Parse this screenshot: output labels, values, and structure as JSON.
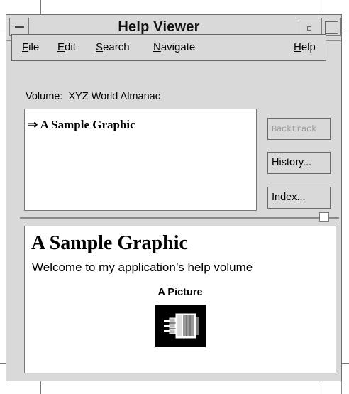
{
  "window": {
    "title": "Help Viewer",
    "window_menu_icon": "window-menu-icon",
    "minimize_icon": "minimize-icon",
    "maximize_icon": "maximize-icon"
  },
  "menubar": {
    "items": [
      {
        "label": "File",
        "mnemonic": "F"
      },
      {
        "label": "Edit",
        "mnemonic": "E"
      },
      {
        "label": "Search",
        "mnemonic": "S"
      },
      {
        "label": "Navigate",
        "mnemonic": "N"
      },
      {
        "label": "Help",
        "mnemonic": "H"
      }
    ]
  },
  "volume": {
    "label": "Volume:",
    "name": "XYZ World Almanac"
  },
  "topic_list": {
    "current_marker": "⇒",
    "current_topic": "A Sample Graphic"
  },
  "buttons": {
    "backtrack": "Backtrack",
    "history": "History...",
    "index": "Index..."
  },
  "content": {
    "heading": "A Sample Graphic",
    "welcome": "Welcome to my application’s help volume",
    "picture_caption": "A Picture",
    "picture_icon": "graphic-picture-icon"
  }
}
